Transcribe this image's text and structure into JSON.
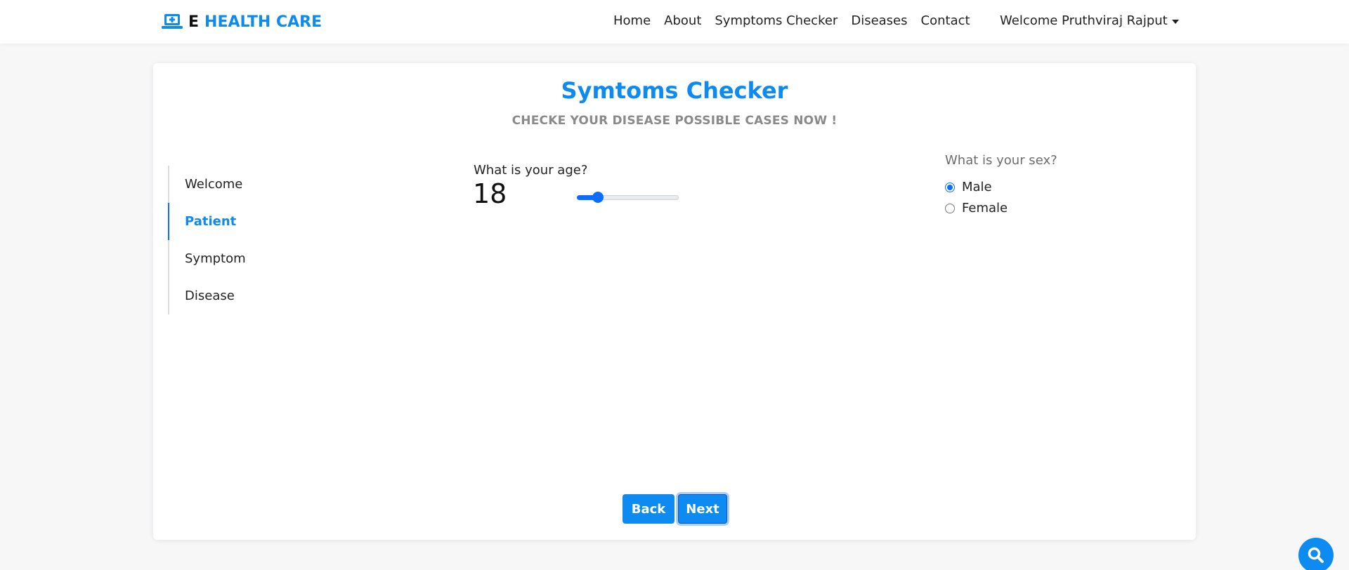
{
  "brand": {
    "prefix": "E",
    "name": "HEALTH CARE",
    "icon": "laptop-medical-icon"
  },
  "nav": {
    "links": [
      "Home",
      "About",
      "Symptoms Checker",
      "Diseases",
      "Contact"
    ],
    "user": "Welcome Pruthviraj Rajput"
  },
  "page": {
    "title": "Symtoms Checker",
    "subtitle": "CHECKE YOUR DISEASE POSSIBLE CASES NOW !"
  },
  "steps": {
    "items": [
      "Welcome",
      "Patient",
      "Symptom",
      "Disease"
    ],
    "active": "Patient"
  },
  "age": {
    "label": "What is your age?",
    "value": "18",
    "slider_fraction": 0.21
  },
  "sex": {
    "label": "What is your sex?",
    "options": [
      "Male",
      "Female"
    ],
    "selected": "Male"
  },
  "buttons": {
    "back": "Back",
    "next": "Next"
  },
  "fab": {
    "icon": "search-icon"
  },
  "colors": {
    "accent": "#0d8bf0",
    "primary": "#0d6efd",
    "muted": "#8a8a8a"
  }
}
